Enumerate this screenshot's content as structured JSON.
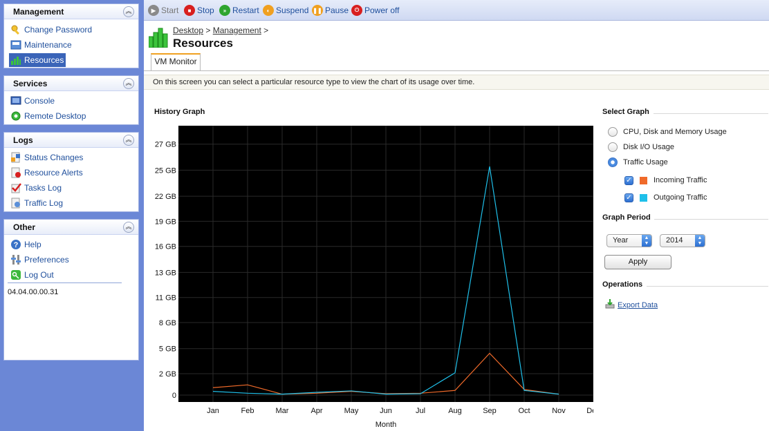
{
  "sidebar": {
    "panels": [
      {
        "title": "Management",
        "items": [
          {
            "label": "Change Password",
            "icon": "key-icon"
          },
          {
            "label": "Maintenance",
            "icon": "maintenance-icon"
          },
          {
            "label": "Resources",
            "icon": "resources-chart-icon",
            "active": true
          }
        ]
      },
      {
        "title": "Services",
        "items": [
          {
            "label": "Console",
            "icon": "console-icon"
          },
          {
            "label": "Remote Desktop",
            "icon": "remote-desktop-icon"
          }
        ]
      },
      {
        "title": "Logs",
        "items": [
          {
            "label": "Status Changes",
            "icon": "status-changes-icon"
          },
          {
            "label": "Resource Alerts",
            "icon": "resource-alerts-icon"
          },
          {
            "label": "Tasks Log",
            "icon": "tasks-log-icon"
          },
          {
            "label": "Traffic Log",
            "icon": "traffic-log-icon"
          }
        ]
      },
      {
        "title": "Other",
        "items": [
          {
            "label": "Help",
            "icon": "help-icon"
          },
          {
            "label": "Preferences",
            "icon": "preferences-icon"
          },
          {
            "label": "Log Out",
            "icon": "logout-icon"
          }
        ]
      }
    ],
    "version": "04.04.00.00.31"
  },
  "toolbar": {
    "buttons": [
      {
        "label": "Start",
        "icon": "start-icon",
        "color": "#8a8a8a",
        "disabled": true
      },
      {
        "label": "Stop",
        "icon": "stop-icon",
        "color": "#d81f1f"
      },
      {
        "label": "Restart",
        "icon": "restart-icon",
        "color": "#2fa52f"
      },
      {
        "label": "Suspend",
        "icon": "suspend-icon",
        "color": "#f0a020"
      },
      {
        "label": "Pause",
        "icon": "pause-icon",
        "color": "#f0a020"
      },
      {
        "label": "Power off",
        "icon": "power-off-icon",
        "color": "#d81f1f"
      }
    ]
  },
  "header": {
    "breadcrumb": {
      "desktop": "Desktop",
      "management": "Management",
      "sep": ">"
    },
    "title": "Resources",
    "tab": "VM Monitor"
  },
  "info_text": "On this screen you can select a particular resource type to view the chart of its usage over time.",
  "history_graph_title": "History Graph",
  "chart_data": {
    "type": "line",
    "xlabel": "Month",
    "ylabel": "",
    "categories": [
      "Jan",
      "Feb",
      "Mar",
      "Apr",
      "May",
      "Jun",
      "Jul",
      "Aug",
      "Sep",
      "Oct",
      "Nov",
      "Dec"
    ],
    "y_ticks": [
      "0",
      "2 GB",
      "5 GB",
      "8 GB",
      "11 GB",
      "13 GB",
      "16 GB",
      "19 GB",
      "22 GB",
      "25 GB",
      "27 GB"
    ],
    "ylim": [
      0,
      27.5
    ],
    "series": [
      {
        "name": "Incoming Traffic",
        "color": "#f06a2a",
        "values": [
          0.8,
          1.1,
          0.1,
          0.2,
          0.4,
          0.15,
          0.2,
          0.5,
          4.5,
          0.6,
          0.1,
          null
        ]
      },
      {
        "name": "Outgoing Traffic",
        "color": "#1fc0ea",
        "values": [
          0.4,
          0.2,
          0.1,
          0.3,
          0.45,
          0.1,
          0.15,
          2.4,
          24.6,
          0.5,
          0.1,
          null
        ]
      }
    ],
    "background": "#000000",
    "grid": true
  },
  "right_panel": {
    "select_graph_title": "Select Graph",
    "options": [
      {
        "label": "CPU, Disk and Memory Usage",
        "checked": false
      },
      {
        "label": "Disk I/O Usage",
        "checked": false
      },
      {
        "label": "Traffic Usage",
        "checked": true
      }
    ],
    "traffic_checks": [
      {
        "label": "Incoming Traffic",
        "color": "#f06a2a",
        "checked": true
      },
      {
        "label": "Outgoing Traffic",
        "color": "#1fc0ea",
        "checked": true
      }
    ],
    "graph_period_title": "Graph Period",
    "period_select": "Year",
    "year_select": "2014",
    "apply_label": "Apply",
    "operations_title": "Operations",
    "export_label": "Export Data"
  }
}
